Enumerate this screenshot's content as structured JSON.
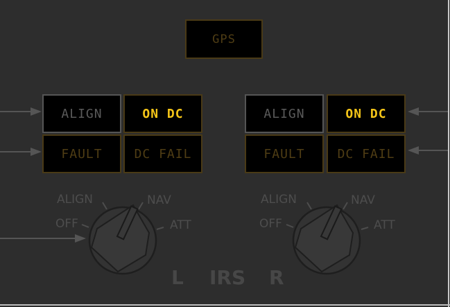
{
  "gps": {
    "label": "GPS"
  },
  "left_unit": {
    "align": "ALIGN",
    "on_dc": "ON DC",
    "fault": "FAULT",
    "dc_fail": "DC FAIL",
    "selector": {
      "labels": {
        "align": "ALIGN",
        "nav": "NAV",
        "off": "OFF",
        "att": "ATT"
      },
      "position": "NAV"
    }
  },
  "right_unit": {
    "align": "ALIGN",
    "on_dc": "ON DC",
    "fault": "FAULT",
    "dc_fail": "DC FAIL",
    "selector": {
      "labels": {
        "align": "ALIGN",
        "nav": "NAV",
        "off": "OFF",
        "att": "ATT"
      },
      "position": "NAV"
    }
  },
  "footer": {
    "left": "L",
    "center": "IRS",
    "right": "R"
  },
  "colors": {
    "background": "#2d2d2d",
    "annunciator_on": "#f5c518",
    "annunciator_off": "#4f3d14",
    "label_gray": "#5a5a5a"
  }
}
